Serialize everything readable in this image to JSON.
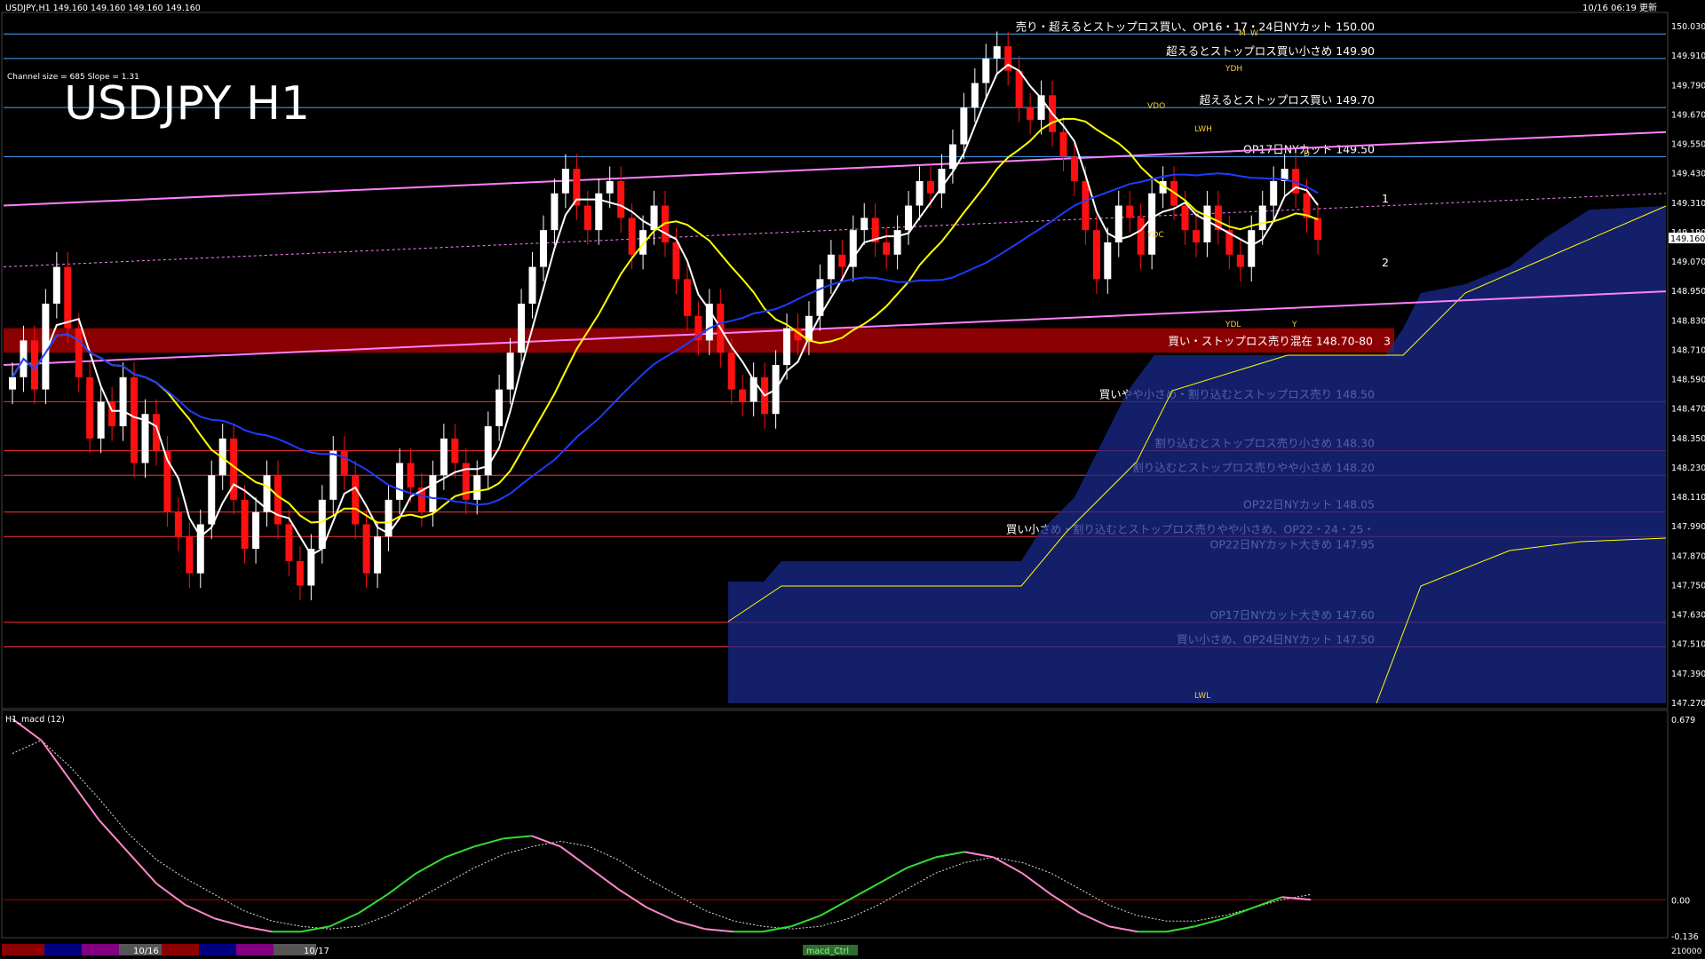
{
  "header": {
    "symbol_line": "USDJPY,H1  149.160 149.160 149.160 149.160",
    "timestamp": "10/16 06:19 更新",
    "channel_info": "Channel size = 685 Slope = 1.31",
    "big_title": "USDJPY H1"
  },
  "colors": {
    "background": "#000000",
    "bull_candle": "#ffffff",
    "bear_candle": "#ff1010",
    "ma_fast": "#ffffff",
    "ma_mid": "#ffff00",
    "ma_slow": "#1e3cff",
    "channel": "#ff80ff",
    "level_blue": "#4aa8ff",
    "level_red": "#ff3030",
    "zone": "#8b0000",
    "cloud_fill": "#1a2a8c",
    "macd_green": "#33dd33",
    "macd_pink": "#ff88cc"
  },
  "chart_data": {
    "type": "candlestick",
    "title": "USDJPY H1",
    "ylim": [
      147.27,
      150.03
    ],
    "price_axis_ticks": [
      "150.030",
      "149.910",
      "149.790",
      "149.670",
      "149.550",
      "149.430",
      "149.310",
      "149.190",
      "149.070",
      "148.950",
      "148.830",
      "148.710",
      "148.590",
      "148.470",
      "148.350",
      "148.230",
      "148.110",
      "147.990",
      "147.870",
      "147.750",
      "147.630",
      "147.510",
      "147.390",
      "147.270"
    ],
    "current_price": "149.160",
    "current_price_value": 149.16,
    "candles_close": [
      148.6,
      148.75,
      148.55,
      148.9,
      149.05,
      148.8,
      148.6,
      148.35,
      148.5,
      148.4,
      148.6,
      148.25,
      148.45,
      148.3,
      148.05,
      147.95,
      147.8,
      148.0,
      148.2,
      148.35,
      148.1,
      147.9,
      148.05,
      148.2,
      148.0,
      147.85,
      147.75,
      147.9,
      148.1,
      148.3,
      148.2,
      148.0,
      147.8,
      147.95,
      148.1,
      148.25,
      148.15,
      148.05,
      148.2,
      148.35,
      148.25,
      148.1,
      148.2,
      148.4,
      148.55,
      148.7,
      148.9,
      149.05,
      149.2,
      149.35,
      149.45,
      149.3,
      149.2,
      149.35,
      149.4,
      149.25,
      149.1,
      149.2,
      149.3,
      149.15,
      149.0,
      148.85,
      148.75,
      148.9,
      148.7,
      148.55,
      148.5,
      148.6,
      148.45,
      148.65,
      148.8,
      148.75,
      148.85,
      149.0,
      149.1,
      149.05,
      149.2,
      149.25,
      149.15,
      149.1,
      149.2,
      149.3,
      149.4,
      149.35,
      149.45,
      149.55,
      149.7,
      149.8,
      149.9,
      149.95,
      149.85,
      149.7,
      149.65,
      149.75,
      149.6,
      149.5,
      149.4,
      149.2,
      149.0,
      149.15,
      149.3,
      149.25,
      149.1,
      149.35,
      149.4,
      149.3,
      149.2,
      149.15,
      149.3,
      149.2,
      149.1,
      149.05,
      149.2,
      149.3,
      149.4,
      149.45,
      149.35,
      149.25,
      149.16
    ],
    "price_levels": [
      {
        "value": 150.0,
        "label": "売り・超えるとストップロス買い、OP16・17・24日NYカット 150.00",
        "color": "blue"
      },
      {
        "value": 149.9,
        "label": "超えるとストップロス買い小さめ 149.90",
        "color": "blue"
      },
      {
        "value": 149.7,
        "label": "超えるとストップロス買い 149.70",
        "color": "blue"
      },
      {
        "value": 149.5,
        "label": "OP17日NYカット 149.50",
        "color": "blue"
      },
      {
        "value": 148.5,
        "label": "買いやや小さめ・割り込むとストップロス売り 148.50",
        "color": "red"
      },
      {
        "value": 148.3,
        "label": "割り込むとストップロス売り小さめ 148.30",
        "color": "red"
      },
      {
        "value": 148.2,
        "label": "割り込むとストップロス売りやや小さめ 148.20",
        "color": "red"
      },
      {
        "value": 148.05,
        "label": "OP22日NYカット 148.05",
        "color": "red"
      },
      {
        "value": 147.95,
        "label": "買い小さめ・割り込むとストップロス売りやや小さめ、OP22・24・25・",
        "color": "red"
      },
      {
        "value": 147.6,
        "label": "OP17日NYカット大きめ 147.60",
        "color": "red"
      },
      {
        "value": 147.5,
        "label": "買い小さめ、OP24日NYカット 147.50",
        "color": "red"
      }
    ],
    "level_continuation": "OP22日NYカット大きめ 147.95",
    "support_zone": {
      "from": 148.7,
      "to": 148.8,
      "label": "買い・ストップロス売り混在 148.70-80"
    },
    "channel_lines": [
      {
        "name": "upper",
        "start": 149.3,
        "end": 149.6
      },
      {
        "name": "middle",
        "start": 149.05,
        "end": 149.35
      },
      {
        "name": "lower",
        "start": 148.65,
        "end": 148.95
      }
    ],
    "markers": [
      "YDH",
      "VDO",
      "LWH",
      "YDC",
      "YDL",
      "LWL",
      "M",
      "W",
      "D",
      "Y"
    ],
    "projection_labels": [
      "1",
      "2",
      "3"
    ],
    "macd": {
      "label": "H1_macd (12)",
      "ticks": [
        "0.679",
        "0.00",
        "-0.136"
      ],
      "ylim": [
        -0.136,
        0.679
      ],
      "signal": [
        0.55,
        0.6,
        0.5,
        0.38,
        0.25,
        0.15,
        0.08,
        0.02,
        -0.04,
        -0.08,
        -0.1,
        -0.11,
        -0.1,
        -0.06,
        0.0,
        0.06,
        0.12,
        0.17,
        0.2,
        0.22,
        0.2,
        0.15,
        0.08,
        0.02,
        -0.04,
        -0.08,
        -0.1,
        -0.11,
        -0.1,
        -0.07,
        -0.02,
        0.04,
        0.1,
        0.14,
        0.16,
        0.14,
        0.1,
        0.04,
        -0.02,
        -0.06,
        -0.08,
        -0.08,
        -0.06,
        -0.03,
        0.0,
        0.02
      ],
      "line": [
        0.68,
        0.6,
        0.45,
        0.3,
        0.18,
        0.06,
        -0.02,
        -0.07,
        -0.1,
        -0.12,
        -0.12,
        -0.1,
        -0.05,
        0.02,
        0.1,
        0.16,
        0.2,
        0.23,
        0.24,
        0.2,
        0.12,
        0.04,
        -0.03,
        -0.08,
        -0.11,
        -0.12,
        -0.12,
        -0.1,
        -0.06,
        0.0,
        0.06,
        0.12,
        0.16,
        0.18,
        0.16,
        0.1,
        0.02,
        -0.05,
        -0.1,
        -0.12,
        -0.12,
        -0.1,
        -0.07,
        -0.03,
        0.01,
        0.0
      ]
    },
    "bottom_time_labels": [
      "10/16",
      "10/17"
    ],
    "bottom_right": "210000",
    "macd_button": "macd_Ctrl"
  }
}
